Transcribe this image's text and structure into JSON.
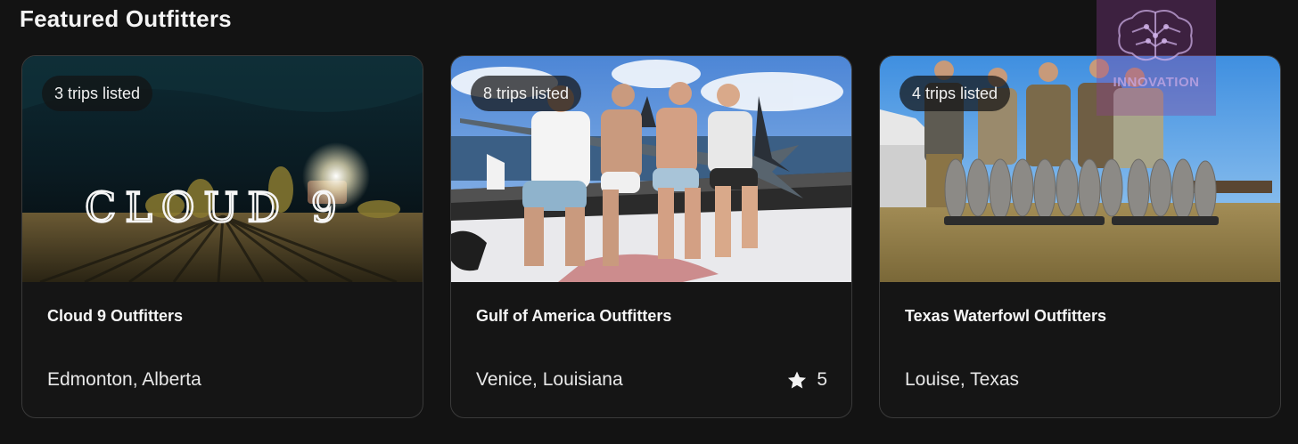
{
  "section": {
    "title": "Featured Outfitters"
  },
  "cards": [
    {
      "badge": "3 trips listed",
      "name": "Cloud 9 Outfitters",
      "location": "Edmonton, Alberta",
      "rating": "",
      "image_text": "CLOUD 9"
    },
    {
      "badge": "8 trips listed",
      "name": "Gulf of America Outfitters",
      "location": "Venice, Louisiana",
      "rating": "5"
    },
    {
      "badge": "4 trips listed",
      "name": "Texas Waterfowl Outfitters",
      "location": "Louise, Texas",
      "rating": ""
    }
  ],
  "watermark": {
    "text": "INNOVATION"
  },
  "colors": {
    "background": "#131313",
    "card_border": "#3a3a3a",
    "text_primary": "#f2f2f2"
  },
  "icons": {
    "rating": "star-icon"
  }
}
